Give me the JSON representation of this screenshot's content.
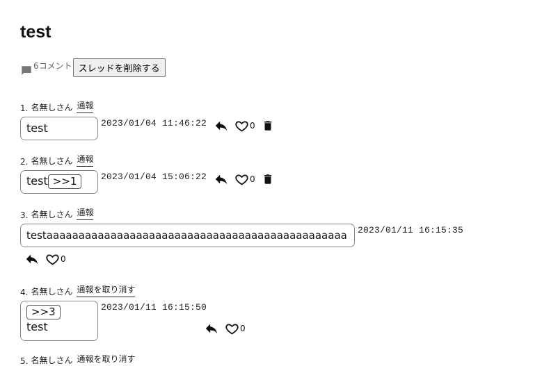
{
  "thread": {
    "title": "test",
    "comment_count": "6コメント",
    "delete_thread_label": "スレッドを削除する"
  },
  "posts": [
    {
      "number": "1.",
      "author": "名無しさん",
      "report_label": "通報",
      "anchor": "",
      "text": "test",
      "timestamp": "2023/01/04 11:46:22",
      "likes": "0",
      "deletable": true
    },
    {
      "number": "2.",
      "author": "名無しさん",
      "report_label": "通報",
      "anchor": ">>1",
      "text": "test",
      "timestamp": "2023/01/04 15:06:22",
      "likes": "0",
      "deletable": true
    },
    {
      "number": "3.",
      "author": "名無しさん",
      "report_label": "通報",
      "anchor": "",
      "text": "testaaaaaaaaaaaaaaaaaaaaaaaaaaaaaaaaaaaaaaaaaaaaaaa",
      "timestamp": "2023/01/11 16:15:35",
      "likes": "0",
      "deletable": false
    },
    {
      "number": "4.",
      "author": "名無しさん",
      "report_label": "通報を取り消す",
      "anchor": ">>3",
      "text": "test",
      "timestamp": "2023/01/11 16:15:50",
      "likes": "0",
      "deletable": false
    },
    {
      "number": "5.",
      "author": "名無しさん",
      "report_label": "通報を取り消す"
    }
  ],
  "icons": {
    "comment": "comment-icon",
    "reply": "reply-icon",
    "like": "heart-icon",
    "delete": "trash-icon"
  }
}
